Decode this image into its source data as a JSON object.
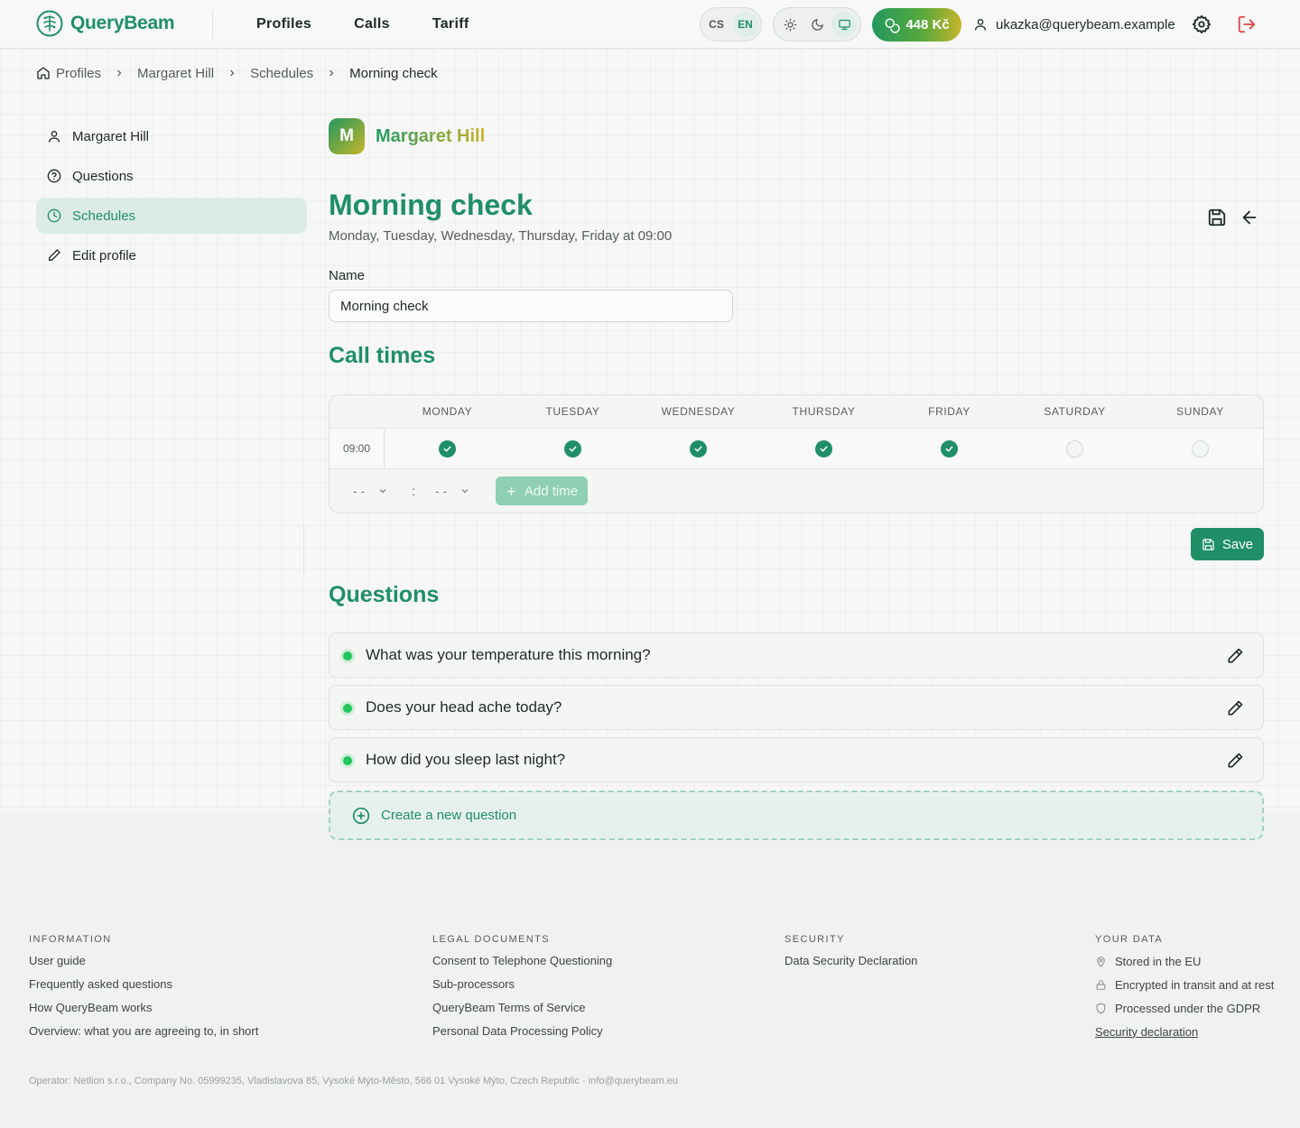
{
  "app": {
    "name": "QueryBeam",
    "accent": "#1f8f67",
    "accent_light": "#dcece4",
    "brand_gradient_end": "#c6b52a"
  },
  "header": {
    "nav": [
      "Profiles",
      "Calls",
      "Tariff"
    ],
    "lang": {
      "cs": "CS",
      "en": "EN",
      "selected": "EN"
    },
    "theme_options": [
      "sun-icon",
      "moon-icon",
      "monitor-icon"
    ],
    "theme_selected": "monitor-icon",
    "credit": "448 Kč",
    "user_email": "ukazka@querybeam.example"
  },
  "breadcrumb": [
    "Profiles",
    "Margaret Hill",
    "Schedules",
    "Morning check"
  ],
  "sidebar": {
    "items": [
      {
        "label": "Margaret Hill",
        "icon": "user-icon"
      },
      {
        "label": "Questions",
        "icon": "help-circle-icon"
      },
      {
        "label": "Schedules",
        "icon": "clock-icon",
        "active": true
      },
      {
        "label": "Edit profile",
        "icon": "pencil-icon"
      }
    ]
  },
  "profile": {
    "initial": "M",
    "name": "Margaret Hill"
  },
  "schedule": {
    "title": "Morning check",
    "summary": "Monday, Tuesday, Wednesday, Thursday, Friday at 09:00",
    "name_label": "Name",
    "name_value": "Morning check"
  },
  "call_times": {
    "heading": "Call times",
    "days": [
      "MONDAY",
      "TUESDAY",
      "WEDNESDAY",
      "THURSDAY",
      "FRIDAY",
      "SATURDAY",
      "SUNDAY"
    ],
    "rows": [
      {
        "time": "09:00",
        "checked": [
          true,
          true,
          true,
          true,
          true,
          false,
          false
        ]
      }
    ],
    "hour_placeholder": "- -",
    "minute_placeholder": "- -",
    "separator": ":",
    "add_time_label": "Add time",
    "save_label": "Save"
  },
  "questions": {
    "heading": "Questions",
    "items": [
      "What was your temperature this morning?",
      "Does your head ache today?",
      "How did you sleep last night?"
    ],
    "create_label": "Create a new question"
  },
  "footer": {
    "information": {
      "heading": "INFORMATION",
      "links": [
        "User guide",
        "Frequently asked questions",
        "How QueryBeam works",
        "Overview: what you are agreeing to, in short"
      ]
    },
    "legal": {
      "heading": "LEGAL DOCUMENTS",
      "links": [
        "Consent to Telephone Questioning",
        "Sub-processors",
        "QueryBeam Terms of Service",
        "Personal Data Processing Policy"
      ]
    },
    "security": {
      "heading": "SECURITY",
      "links": [
        "Data Security Declaration"
      ]
    },
    "your_data": {
      "heading": "YOUR DATA",
      "items": [
        {
          "label": "Stored in the EU",
          "icon": "map-pin-icon"
        },
        {
          "label": "Encrypted in transit and at rest",
          "icon": "lock-icon"
        },
        {
          "label": "Processed under the GDPR",
          "icon": "shield-icon"
        }
      ],
      "link": "Security declaration"
    },
    "operator": "Operator: Netlion s.r.o., Company No. 05999235, Vladislavova 85, Vysoké Mýto-Město, 566 01 Vysoké Mýto, Czech Republic · info@querybeam.eu"
  }
}
